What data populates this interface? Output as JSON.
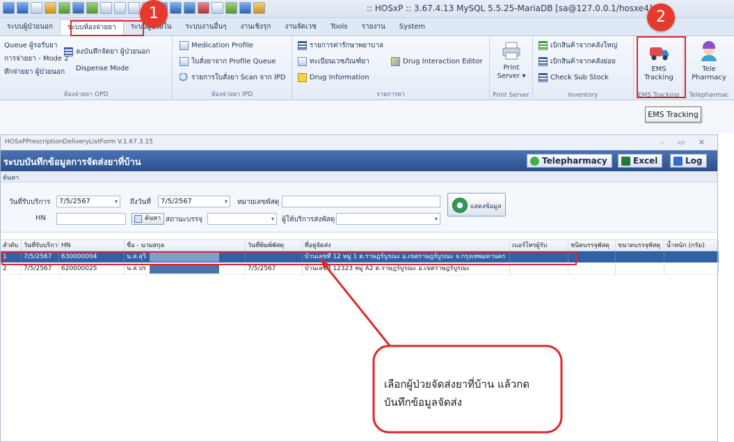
{
  "app": {
    "title": ":: HOSxP :: 3.67.4.13 MySQL 5.5.25-MariaDB [sa@127.0.0.1/hosxe4]"
  },
  "ribbon_tabs": [
    {
      "label": "ระบบผู้ป่วยนอก"
    },
    {
      "label": "ระบบห้องจ่ายยา"
    },
    {
      "label": "ระบบผู้ป่วยใน"
    },
    {
      "label": "ระบบงานอื่นๆ"
    },
    {
      "label": "งานเชิงรุก"
    },
    {
      "label": "งานจัดเวช"
    },
    {
      "label": "Tools"
    },
    {
      "label": "รายงาน"
    },
    {
      "label": "System"
    }
  ],
  "annotations": {
    "step1": "1",
    "step2": "2",
    "callout": "เลือกผู้ป่วยจัดส่งยาที่บ้าน แล้วกด บันทึกข้อมูลจัดส่ง"
  },
  "ribbon": {
    "opd": {
      "items": [
        "Queue ผู้รอรับยา",
        "การจ่ายยา - Mode 2",
        "ทึกจ่ายยา ผู้ป่วยนอก"
      ],
      "record": "ลงบันทึกจัดยา ผู้ป่วยนอก",
      "dispense": "Dispense Mode",
      "label": "ห้องจ่ายยา OPD"
    },
    "ipd": {
      "items": [
        "Medication Profile",
        "ใบสั่งยาจาก Profile Queue",
        "รายการใบสั่งยา Scan จาก IPD"
      ],
      "label": "ห้องจ่ายยา IPD"
    },
    "list": {
      "items": [
        "รายการค่ารักษาพยาบาล",
        "ทะเบียนเวชภัณฑ์ยา",
        "Drug Information"
      ],
      "interaction": "Drug Interaction Editor",
      "label": "รายการยา"
    },
    "print": {
      "line1": "Print",
      "line2": "Server",
      "label": "Print Server"
    },
    "inventory": {
      "items": [
        "เบิกสินค้าจากคลังใหญ่",
        "เบิกสินค้าจากคลังย่อย",
        "Check Sub Stock"
      ],
      "label": "Inventory"
    },
    "ems": {
      "line1": "EMS",
      "line2": "Tracking",
      "label": "EMS Tracking"
    },
    "tele": {
      "line1": "Tele",
      "line2": "Pharmacy",
      "label": "Telepharmac"
    }
  },
  "tooltip": "EMS Tracking",
  "window": {
    "title": "HOSxPPrescriptionDeliveryListForm V.1.67.3.15",
    "controls": "– ▭ ✕",
    "header": "ระบบบันทึกข้อมูลการจัดส่งยาที่บ้าน",
    "btn_tele": "Telepharmacy",
    "btn_excel": "Excel",
    "btn_log": "Log",
    "search_caption": "ค้นหา",
    "filter": {
      "date_label": "วันที่รับบริการ",
      "date_value": "7/5/2567",
      "to_label": "ถึงวันที่",
      "to_value": "7/5/2567",
      "parcel_label": "หมายเลขพัสดุ",
      "hn_label": "HN",
      "search_btn": "ค้นหา",
      "pack_label": "สถานะบรรจุ",
      "provider_label": "ผู้ให้บริการส่งพัสดุ",
      "show_btn": "แสดงข้อมูล"
    },
    "columns": [
      "ลำดับ",
      "วันที่รับบริการ",
      "HN",
      "ชื่อ - นามสกุล",
      "วันที่พิมพ์พัสดุ",
      "ที่อยู่จัดส่ง",
      "เบอร์โทรผู้รับ",
      "ชนิดบรรจุพัสดุ",
      "ขนาดบรรจุพัสดุ",
      "น้ำหนัก (กรัม)"
    ],
    "rows": [
      {
        "no": "1",
        "date": "7/5/2567",
        "hn": "630000004",
        "name": "น.ส.สุวิ",
        "print_date": "",
        "address": "บ้านเลขที่ 12 หมู่ 1  ต.ราษฎร์บูรณะ อ.เขตราษฎร์บูรณะ จ.กรุงเทพมหานคร",
        "phone": "",
        "type": "",
        "size": "",
        "weight": ""
      },
      {
        "no": "2",
        "date": "7/5/2567",
        "hn": "620000025",
        "name": "น.ส.ปร",
        "print_date": "7/5/2567",
        "address": "บ้านเลขที่ 12323 หมู่ A2  ต.ราษฎร์บูรณะ อ.เขตราษฎร์บูรณะ",
        "phone": "",
        "type": "",
        "size": "",
        "weight": ""
      }
    ]
  },
  "colors": {
    "highlight": "#e0262b",
    "selected_row": "#3161a5",
    "header_bar": "#2b4f8d"
  }
}
